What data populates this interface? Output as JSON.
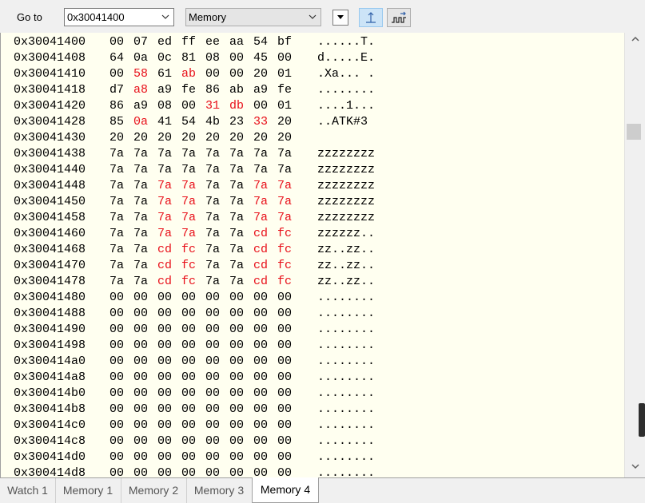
{
  "toolbar": {
    "goto_label": "Go to",
    "address_value": "0x30041400",
    "memory_select": "Memory"
  },
  "memory": {
    "rows": [
      {
        "address": "0x30041400",
        "bytes": [
          "00",
          "07",
          "ed",
          "ff",
          "ee",
          "aa",
          "54",
          "bf"
        ],
        "changed": [],
        "ascii": "......T."
      },
      {
        "address": "0x30041408",
        "bytes": [
          "64",
          "0a",
          "0c",
          "81",
          "08",
          "00",
          "45",
          "00"
        ],
        "changed": [],
        "ascii": "d.....E."
      },
      {
        "address": "0x30041410",
        "bytes": [
          "00",
          "58",
          "61",
          "ab",
          "00",
          "00",
          "20",
          "01"
        ],
        "changed": [
          1,
          3
        ],
        "ascii": ".Xa... ."
      },
      {
        "address": "0x30041418",
        "bytes": [
          "d7",
          "a8",
          "a9",
          "fe",
          "86",
          "ab",
          "a9",
          "fe"
        ],
        "changed": [
          1
        ],
        "ascii": "........"
      },
      {
        "address": "0x30041420",
        "bytes": [
          "86",
          "a9",
          "08",
          "00",
          "31",
          "db",
          "00",
          "01"
        ],
        "changed": [
          4,
          5
        ],
        "ascii": "....1..."
      },
      {
        "address": "0x30041428",
        "bytes": [
          "85",
          "0a",
          "41",
          "54",
          "4b",
          "23",
          "33",
          "20"
        ],
        "changed": [
          1,
          6
        ],
        "ascii": "..ATK#3 "
      },
      {
        "address": "0x30041430",
        "bytes": [
          "20",
          "20",
          "20",
          "20",
          "20",
          "20",
          "20",
          "20"
        ],
        "changed": [],
        "ascii": "        "
      },
      {
        "address": "0x30041438",
        "bytes": [
          "7a",
          "7a",
          "7a",
          "7a",
          "7a",
          "7a",
          "7a",
          "7a"
        ],
        "changed": [],
        "ascii": "zzzzzzzz"
      },
      {
        "address": "0x30041440",
        "bytes": [
          "7a",
          "7a",
          "7a",
          "7a",
          "7a",
          "7a",
          "7a",
          "7a"
        ],
        "changed": [],
        "ascii": "zzzzzzzz"
      },
      {
        "address": "0x30041448",
        "bytes": [
          "7a",
          "7a",
          "7a",
          "7a",
          "7a",
          "7a",
          "7a",
          "7a"
        ],
        "changed": [
          2,
          3,
          6,
          7
        ],
        "ascii": "zzzzzzzz"
      },
      {
        "address": "0x30041450",
        "bytes": [
          "7a",
          "7a",
          "7a",
          "7a",
          "7a",
          "7a",
          "7a",
          "7a"
        ],
        "changed": [
          2,
          3,
          6,
          7
        ],
        "ascii": "zzzzzzzz"
      },
      {
        "address": "0x30041458",
        "bytes": [
          "7a",
          "7a",
          "7a",
          "7a",
          "7a",
          "7a",
          "7a",
          "7a"
        ],
        "changed": [
          2,
          3,
          6,
          7
        ],
        "ascii": "zzzzzzzz"
      },
      {
        "address": "0x30041460",
        "bytes": [
          "7a",
          "7a",
          "7a",
          "7a",
          "7a",
          "7a",
          "cd",
          "fc"
        ],
        "changed": [
          2,
          3,
          6,
          7
        ],
        "ascii": "zzzzzz.."
      },
      {
        "address": "0x30041468",
        "bytes": [
          "7a",
          "7a",
          "cd",
          "fc",
          "7a",
          "7a",
          "cd",
          "fc"
        ],
        "changed": [
          2,
          3,
          6,
          7
        ],
        "ascii": "zz..zz.."
      },
      {
        "address": "0x30041470",
        "bytes": [
          "7a",
          "7a",
          "cd",
          "fc",
          "7a",
          "7a",
          "cd",
          "fc"
        ],
        "changed": [
          2,
          3,
          6,
          7
        ],
        "ascii": "zz..zz.."
      },
      {
        "address": "0x30041478",
        "bytes": [
          "7a",
          "7a",
          "cd",
          "fc",
          "7a",
          "7a",
          "cd",
          "fc"
        ],
        "changed": [
          2,
          3,
          6,
          7
        ],
        "ascii": "zz..zz.."
      },
      {
        "address": "0x30041480",
        "bytes": [
          "00",
          "00",
          "00",
          "00",
          "00",
          "00",
          "00",
          "00"
        ],
        "changed": [],
        "ascii": "........"
      },
      {
        "address": "0x30041488",
        "bytes": [
          "00",
          "00",
          "00",
          "00",
          "00",
          "00",
          "00",
          "00"
        ],
        "changed": [],
        "ascii": "........"
      },
      {
        "address": "0x30041490",
        "bytes": [
          "00",
          "00",
          "00",
          "00",
          "00",
          "00",
          "00",
          "00"
        ],
        "changed": [],
        "ascii": "........"
      },
      {
        "address": "0x30041498",
        "bytes": [
          "00",
          "00",
          "00",
          "00",
          "00",
          "00",
          "00",
          "00"
        ],
        "changed": [],
        "ascii": "........"
      },
      {
        "address": "0x300414a0",
        "bytes": [
          "00",
          "00",
          "00",
          "00",
          "00",
          "00",
          "00",
          "00"
        ],
        "changed": [],
        "ascii": "........"
      },
      {
        "address": "0x300414a8",
        "bytes": [
          "00",
          "00",
          "00",
          "00",
          "00",
          "00",
          "00",
          "00"
        ],
        "changed": [],
        "ascii": "........"
      },
      {
        "address": "0x300414b0",
        "bytes": [
          "00",
          "00",
          "00",
          "00",
          "00",
          "00",
          "00",
          "00"
        ],
        "changed": [],
        "ascii": "........"
      },
      {
        "address": "0x300414b8",
        "bytes": [
          "00",
          "00",
          "00",
          "00",
          "00",
          "00",
          "00",
          "00"
        ],
        "changed": [],
        "ascii": "........"
      },
      {
        "address": "0x300414c0",
        "bytes": [
          "00",
          "00",
          "00",
          "00",
          "00",
          "00",
          "00",
          "00"
        ],
        "changed": [],
        "ascii": "........"
      },
      {
        "address": "0x300414c8",
        "bytes": [
          "00",
          "00",
          "00",
          "00",
          "00",
          "00",
          "00",
          "00"
        ],
        "changed": [],
        "ascii": "........"
      },
      {
        "address": "0x300414d0",
        "bytes": [
          "00",
          "00",
          "00",
          "00",
          "00",
          "00",
          "00",
          "00"
        ],
        "changed": [],
        "ascii": "........"
      },
      {
        "address": "0x300414d8",
        "bytes": [
          "00",
          "00",
          "00",
          "00",
          "00",
          "00",
          "00",
          "00"
        ],
        "changed": [],
        "ascii": "........"
      }
    ]
  },
  "tabs": [
    {
      "label": "Watch 1",
      "active": false
    },
    {
      "label": "Memory 1",
      "active": false
    },
    {
      "label": "Memory 2",
      "active": false
    },
    {
      "label": "Memory 3",
      "active": false
    },
    {
      "label": "Memory 4",
      "active": true
    }
  ],
  "colors": {
    "changed_value": "#e8101a",
    "background": "#fffff0"
  }
}
